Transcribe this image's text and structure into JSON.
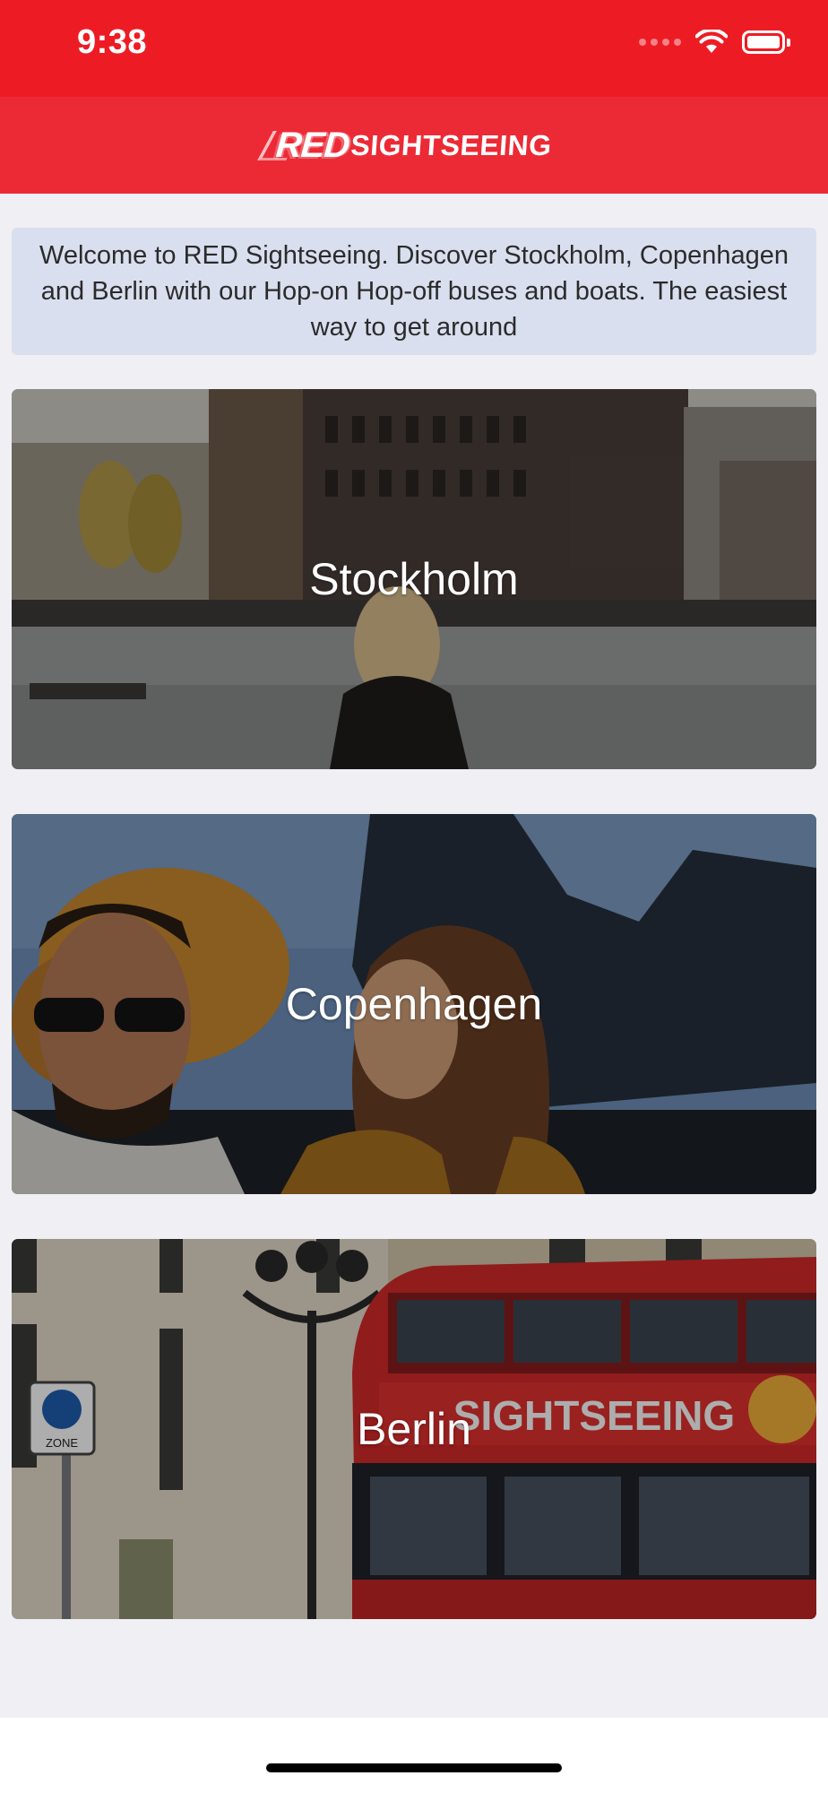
{
  "status_bar": {
    "time": "9:38",
    "background_color": "#ed1c24",
    "icons": [
      "cellular-signal-icon",
      "wifi-icon",
      "battery-icon"
    ]
  },
  "nav_bar": {
    "background_color": "#ec2a35",
    "logo": {
      "part1": "RED",
      "part2": "SIGHTSEEING"
    }
  },
  "welcome": {
    "text": "Welcome to RED Sightseeing. Discover Stockholm, Copenhagen and Berlin with our Hop-on Hop-off buses and boats. The easiest way to get around",
    "background_color": "#d9dfef"
  },
  "cities": [
    {
      "name": "Stockholm"
    },
    {
      "name": "Copenhagen"
    },
    {
      "name": "Berlin"
    }
  ],
  "berlin_bus": {
    "side_text": "SIGHTSEEING",
    "sign_text": "ZONE"
  }
}
